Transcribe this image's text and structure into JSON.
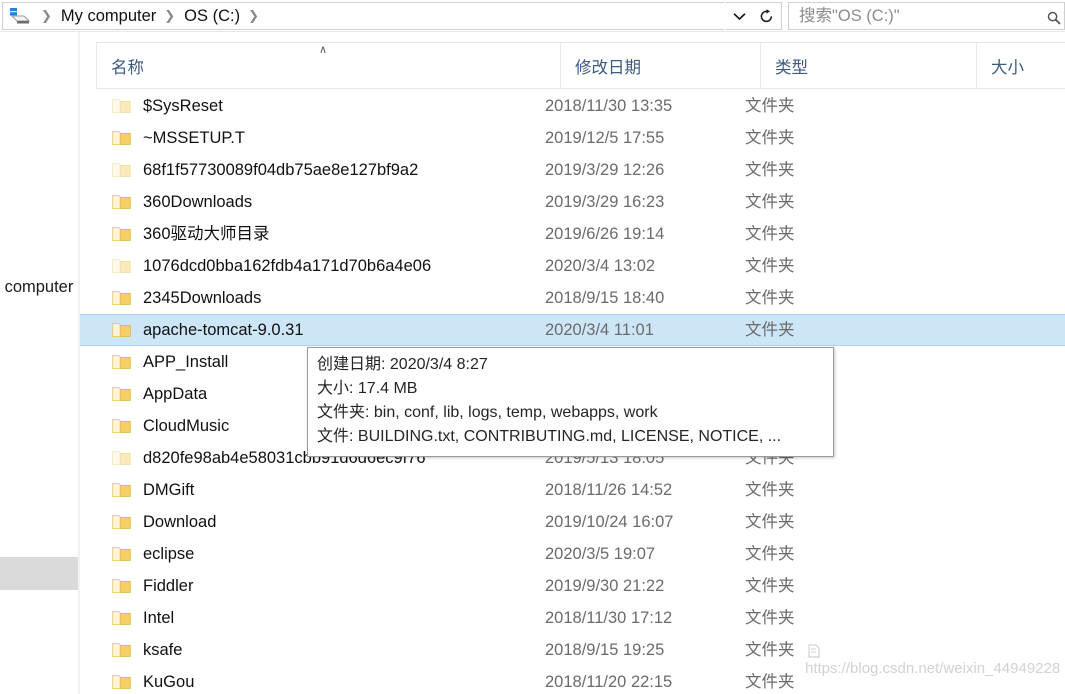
{
  "window": {
    "title": "OS (C:)"
  },
  "addressbar": {
    "pc_icon": "computer-drive-icon",
    "breadcrumbs": [
      {
        "label": "My computer"
      },
      {
        "label": "OS (C:)"
      }
    ],
    "separator": "❯",
    "history_dropdown_icon": "chevron-down-icon",
    "refresh_icon": "refresh-icon"
  },
  "search": {
    "placeholder": "搜索\"OS (C:)\"",
    "value": "",
    "icon": "search-icon"
  },
  "nav_pane": {
    "truncated_label": "My computer",
    "gray_block": "nav-placeholder-block"
  },
  "columns": [
    {
      "key": "name",
      "label": "名称",
      "sorted": "asc",
      "sort_arrow": "∧"
    },
    {
      "key": "date",
      "label": "修改日期",
      "sorted": null
    },
    {
      "key": "type",
      "label": "类型",
      "sorted": null
    },
    {
      "key": "size",
      "label": "大小",
      "sorted": null
    }
  ],
  "colors": {
    "selection_fill": "#cde6f7",
    "selection_border": "#a8d4f0",
    "header_text": "#3d5a80",
    "folder_yellow": "#f7d070",
    "secondary_text": "#6b6b6b"
  },
  "files": [
    {
      "name": "$SysReset",
      "date": "2018/11/30 13:35",
      "type": "文件夹",
      "size": "",
      "hidden": true,
      "selected": false
    },
    {
      "name": "~MSSETUP.T",
      "date": "2019/12/5 17:55",
      "type": "文件夹",
      "size": "",
      "hidden": false,
      "selected": false
    },
    {
      "name": "68f1f57730089f04db75ae8e127bf9a2",
      "date": "2019/3/29 12:26",
      "type": "文件夹",
      "size": "",
      "hidden": true,
      "selected": false
    },
    {
      "name": "360Downloads",
      "date": "2019/3/29 16:23",
      "type": "文件夹",
      "size": "",
      "hidden": false,
      "selected": false
    },
    {
      "name": "360驱动大师目录",
      "date": "2019/6/26 19:14",
      "type": "文件夹",
      "size": "",
      "hidden": false,
      "selected": false
    },
    {
      "name": "1076dcd0bba162fdb4a171d70b6a4e06",
      "date": "2020/3/4 13:02",
      "type": "文件夹",
      "size": "",
      "hidden": true,
      "selected": false
    },
    {
      "name": "2345Downloads",
      "date": "2018/9/15 18:40",
      "type": "文件夹",
      "size": "",
      "hidden": false,
      "selected": false
    },
    {
      "name": "apache-tomcat-9.0.31",
      "date": "2020/3/4 11:01",
      "type": "文件夹",
      "size": "",
      "hidden": false,
      "selected": true
    },
    {
      "name": "APP_Install",
      "date": "",
      "type": "",
      "size": "",
      "hidden": false,
      "selected": false
    },
    {
      "name": "AppData",
      "date": "",
      "type": "",
      "size": "",
      "hidden": false,
      "selected": false
    },
    {
      "name": "CloudMusic",
      "date": "",
      "type": "",
      "size": "",
      "hidden": false,
      "selected": false
    },
    {
      "name": "d820fe98ab4e58031cbb91d6d6ec9f76",
      "date": "2019/5/13 18:05",
      "type": "文件夹",
      "size": "",
      "hidden": true,
      "selected": false
    },
    {
      "name": "DMGift",
      "date": "2018/11/26 14:52",
      "type": "文件夹",
      "size": "",
      "hidden": false,
      "selected": false
    },
    {
      "name": "Download",
      "date": "2019/10/24 16:07",
      "type": "文件夹",
      "size": "",
      "hidden": false,
      "selected": false
    },
    {
      "name": "eclipse",
      "date": "2020/3/5 19:07",
      "type": "文件夹",
      "size": "",
      "hidden": false,
      "selected": false
    },
    {
      "name": "Fiddler",
      "date": "2019/9/30 21:22",
      "type": "文件夹",
      "size": "",
      "hidden": false,
      "selected": false
    },
    {
      "name": "Intel",
      "date": "2018/11/30 17:12",
      "type": "文件夹",
      "size": "",
      "hidden": false,
      "selected": false
    },
    {
      "name": "ksafe",
      "date": "2018/9/15 19:25",
      "type": "文件夹",
      "size": "",
      "hidden": false,
      "selected": false
    },
    {
      "name": "KuGou",
      "date": "2018/11/20 22:15",
      "type": "文件夹",
      "size": "",
      "hidden": false,
      "selected": false
    }
  ],
  "tooltip": {
    "for_item": "apache-tomcat-9.0.31",
    "lines": [
      "创建日期: 2020/3/4 8:27",
      "大小: 17.4 MB",
      "文件夹: bin, conf, lib, logs, temp, webapps, work",
      "文件: BUILDING.txt, CONTRIBUTING.md, LICENSE, NOTICE, ..."
    ]
  },
  "watermark": {
    "text": "https://blog.csdn.net/weixin_44949228"
  }
}
